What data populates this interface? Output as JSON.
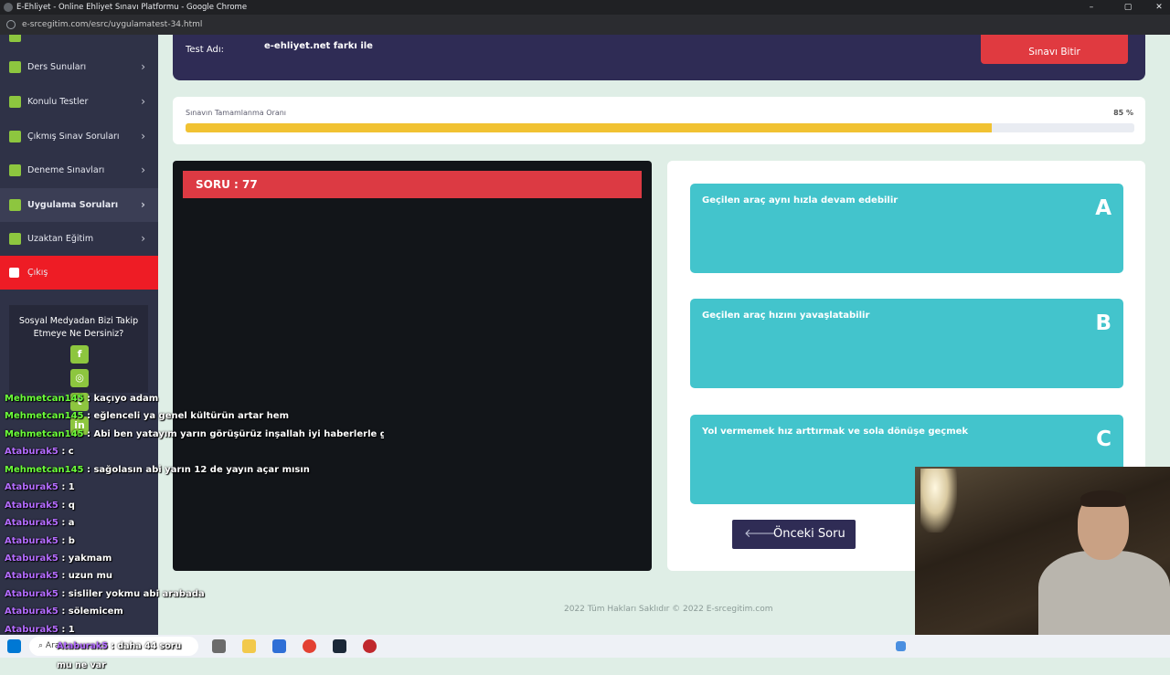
{
  "window": {
    "title": "E-Ehliyet - Online Ehliyet Sınavı Platformu - Google Chrome",
    "url": "e-srcegitim.com/esrc/uygulamatest-34.html"
  },
  "sidebar": {
    "items": [
      {
        "label": "Ders Sunuları"
      },
      {
        "label": "Konulu Testler"
      },
      {
        "label": "Çıkmış Sınav Soruları"
      },
      {
        "label": "Deneme Sınavları"
      },
      {
        "label": "Uygulama Soruları"
      },
      {
        "label": "Uzaktan Eğitim"
      },
      {
        "label": "Çıkış"
      }
    ],
    "social": {
      "text": "Sosyal Medyadan Bizi Takip Etmeye Ne Dersiniz?",
      "icons": [
        "facebook-icon",
        "instagram-icon",
        "twitter-icon",
        "linkedin-icon"
      ]
    }
  },
  "exam": {
    "test_label": "Test Adı:",
    "test_name": "e-ehliyet.net farkı ile",
    "finish_label": "Sınavı Bitir"
  },
  "progress": {
    "title": "Sınavın Tamamlanma Oranı",
    "percent": 85,
    "percent_label": "85 %"
  },
  "question": {
    "header": "SORU : 77"
  },
  "options": [
    {
      "letter": "A",
      "text": "Geçilen araç aynı hızla devam edebilir"
    },
    {
      "letter": "B",
      "text": "Geçilen araç hızını yavaşlatabilir"
    },
    {
      "letter": "C",
      "text": "Yol vermemek hız arttırmak ve sola dönüşe geçmek"
    }
  ],
  "prev_button": "Önceki Soru",
  "footer": "2022 Tüm Hakları Saklıdır © 2022 E-srcegitim.com",
  "chat": [
    {
      "user": "Mehmetcan145",
      "text": " : kaçıyo adam",
      "color": "#6cff3a"
    },
    {
      "user": "Mehmetcan145",
      "text": " : eğlenceli ya genel kültürün artar hem",
      "color": "#6cff3a"
    },
    {
      "user": "Mehmetcan145",
      "text": " : Abi ben yatayım yarın görüşürüz inşallah iyi haberlerle gelirsin",
      "color": "#6cff3a"
    },
    {
      "user": "Ataburak5",
      "text": " : c",
      "color": "#b46cff"
    },
    {
      "user": "Mehmetcan145",
      "text": " : sağolasın abi yarın 12 de yayın açar mısın",
      "color": "#6cff3a"
    },
    {
      "user": "Ataburak5",
      "text": " : 1",
      "color": "#b46cff"
    },
    {
      "user": "Ataburak5",
      "text": " : q",
      "color": "#b46cff"
    },
    {
      "user": "Ataburak5",
      "text": " : a",
      "color": "#b46cff"
    },
    {
      "user": "Ataburak5",
      "text": " : b",
      "color": "#b46cff"
    },
    {
      "user": "Ataburak5",
      "text": " : yakmam",
      "color": "#b46cff"
    },
    {
      "user": "Ataburak5",
      "text": " : uzun mu",
      "color": "#b46cff"
    },
    {
      "user": "Ataburak5",
      "text": " : sisliler yokmu abi arabada",
      "color": "#b46cff"
    },
    {
      "user": "Ataburak5",
      "text": " : sölemicem",
      "color": "#b46cff"
    },
    {
      "user": "Ataburak5",
      "text": " : 1",
      "color": "#b46cff"
    },
    {
      "user": "Ataburak5",
      "text": " : daha 44 soru mu ne var",
      "color": "#b46cff"
    }
  ],
  "taskbar": {
    "search_text": "Ara"
  }
}
